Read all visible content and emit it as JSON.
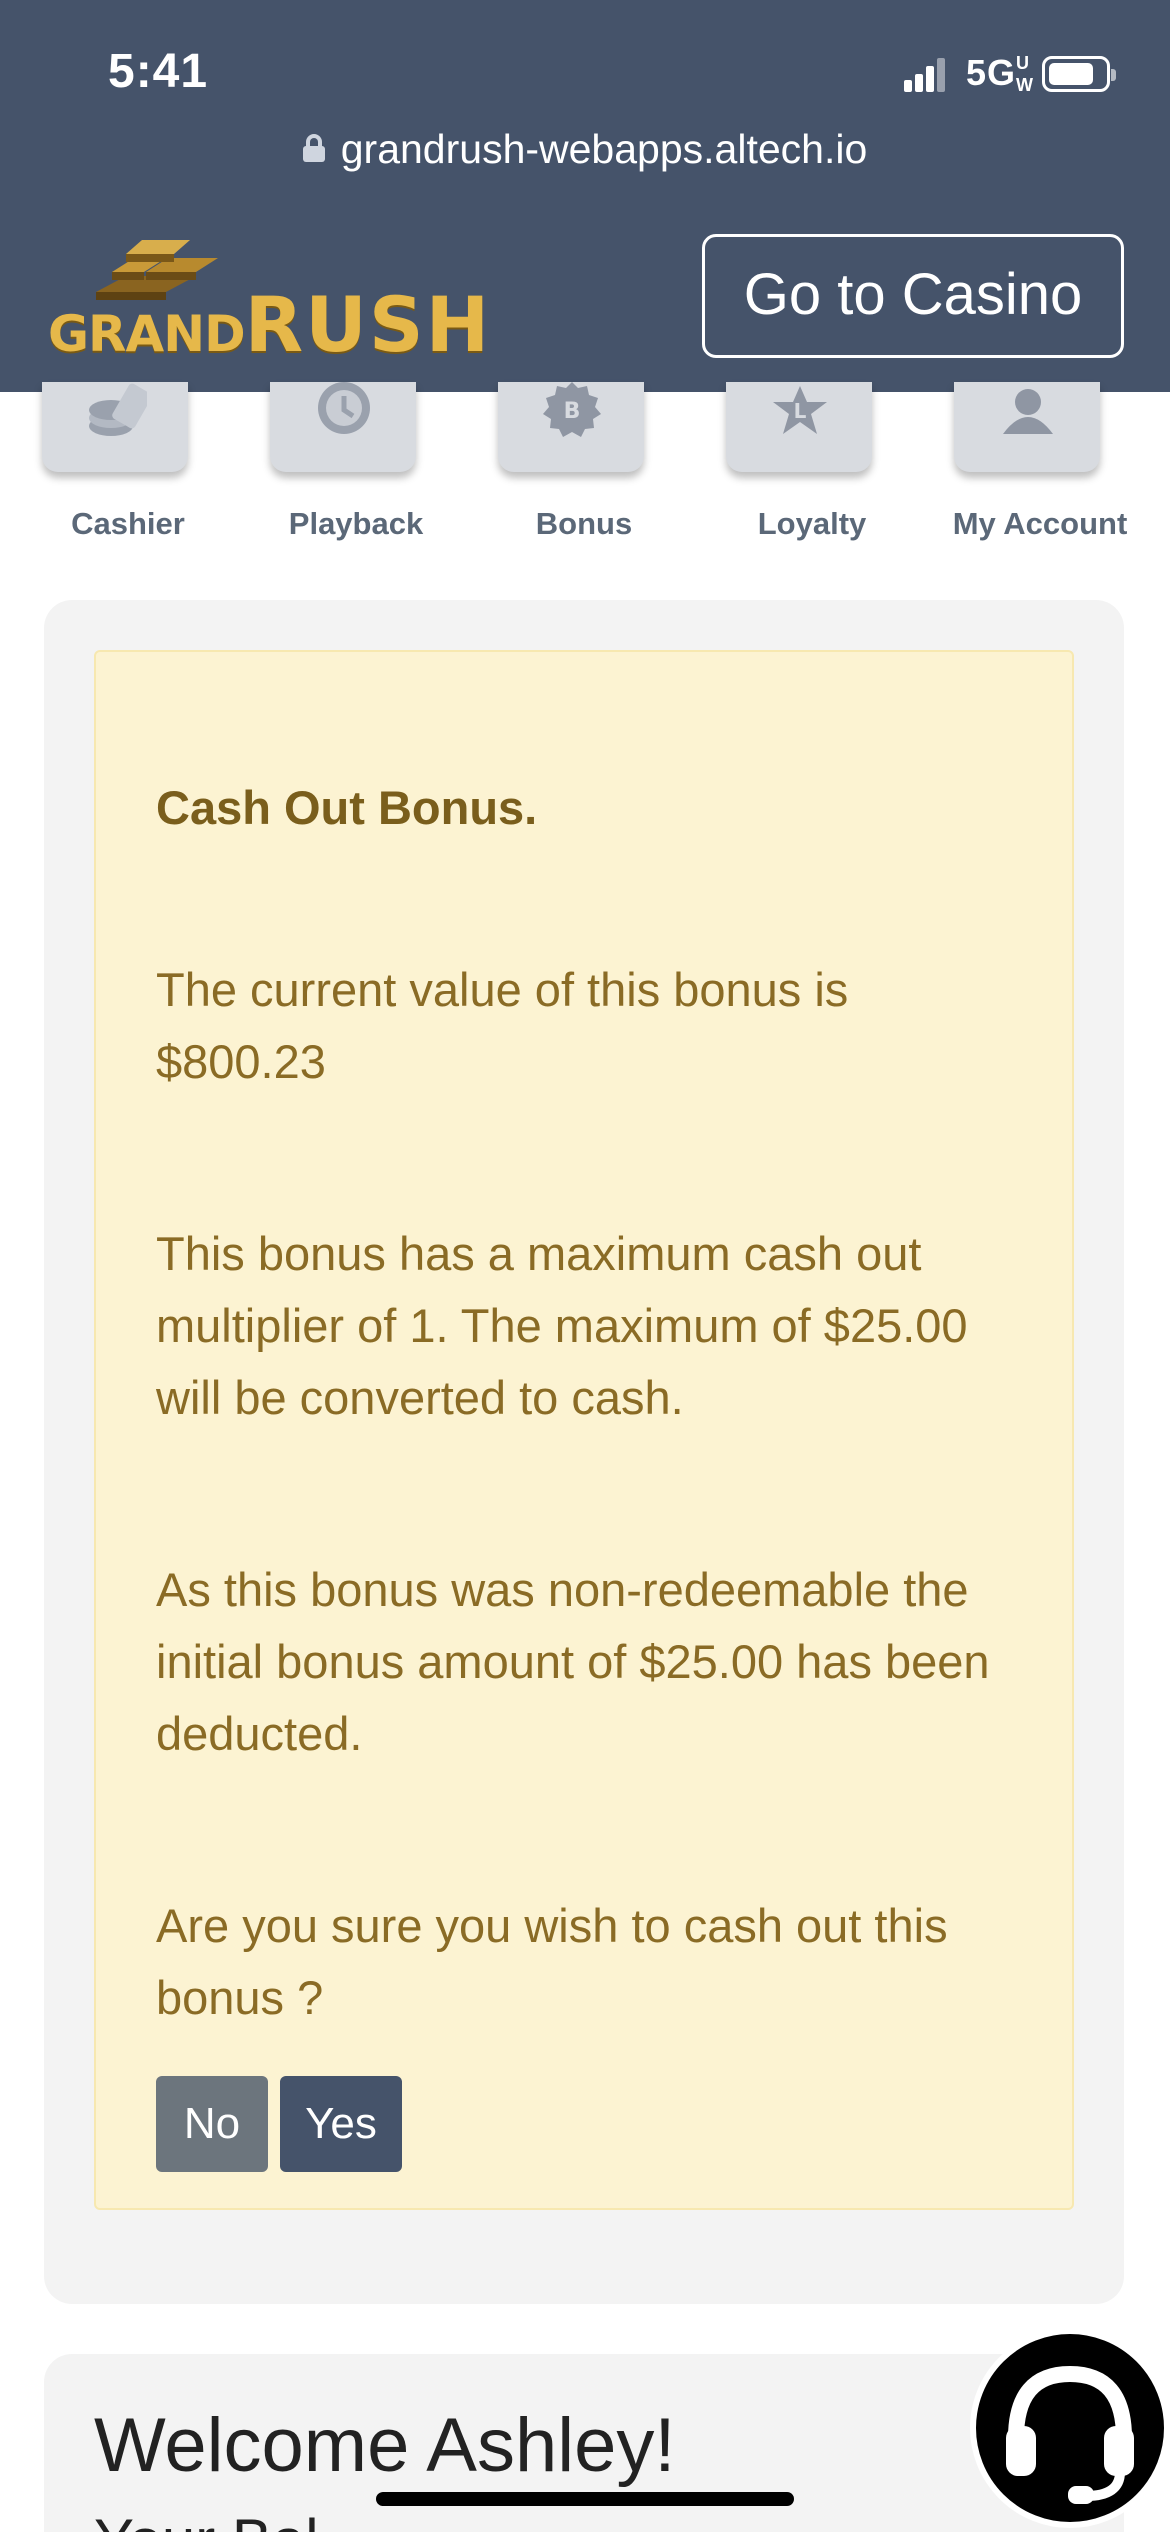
{
  "status_bar": {
    "time": "5:41",
    "network": "5G",
    "network_suffix": "UW",
    "url": "grandrush-webapps.altech.io"
  },
  "header": {
    "logo": {
      "part1": "GRAND",
      "part2": "RUSH"
    },
    "casino_button_label": "Go to Casino"
  },
  "nav": {
    "items": [
      {
        "label": "Cashier",
        "icon": "cashier-icon"
      },
      {
        "label": "Playback",
        "icon": "playback-icon"
      },
      {
        "label": "Bonus",
        "icon": "bonus-icon"
      },
      {
        "label": "Loyalty",
        "icon": "loyalty-icon"
      },
      {
        "label": "My Account",
        "icon": "account-icon"
      }
    ]
  },
  "dialog": {
    "title": "Cash Out Bonus.",
    "p1": "The current value of this bonus is $800.23",
    "p2": "This bonus has a maximum cash out multiplier of 1. The maximum of $25.00 will be converted to cash.",
    "p3": "As this bonus was non-redeemable the initial bonus amount of $25.00 has been deducted.",
    "p4": "Are you sure you wish to cash out this bonus ?",
    "no_label": "No",
    "yes_label": "Yes"
  },
  "welcome": {
    "title": "Welcome Ashley!",
    "subtitle_partial": "Your Bal"
  },
  "colors": {
    "header_bg": "#45536a",
    "alert_bg": "#fcf3d2",
    "alert_text": "#846a25",
    "no_button": "#6c757d",
    "yes_button": "#45536a"
  }
}
